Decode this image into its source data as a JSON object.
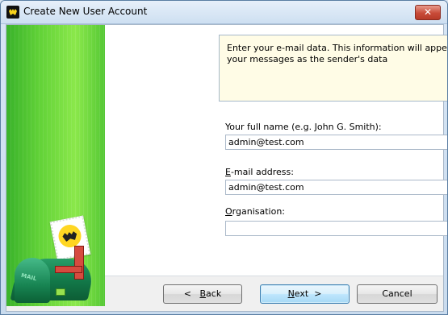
{
  "window": {
    "title": "Create New User Account",
    "close_label": "✕"
  },
  "sidebar": {
    "mailbox_label": "MAIL"
  },
  "info": {
    "text": "Enter your e-mail data. This information will appear by default in your messages as the sender's data"
  },
  "fields": {
    "full_name": {
      "label": "Your full name (e.g. John G. Smith):",
      "value": "admin@test.com"
    },
    "email": {
      "label_first": "E",
      "label_rest": "-mail address:",
      "value": "admin@test.com"
    },
    "organisation": {
      "label_first": "O",
      "label_rest": "rganisation:",
      "value": ""
    }
  },
  "buttons": {
    "back_prefix": "<",
    "back_first": "B",
    "back_rest": "ack",
    "next_first": "N",
    "next_rest": "ext",
    "next_suffix": ">",
    "cancel": "Cancel"
  },
  "colors": {
    "title_bar": "#d8e6f5",
    "sidebar_green": "#63d338",
    "info_background": "#fffce6",
    "close_button": "#c84b38"
  },
  "icons": [
    "bat-app-icon",
    "close-icon",
    "mailbox-icon",
    "bat-stamp-icon"
  ]
}
